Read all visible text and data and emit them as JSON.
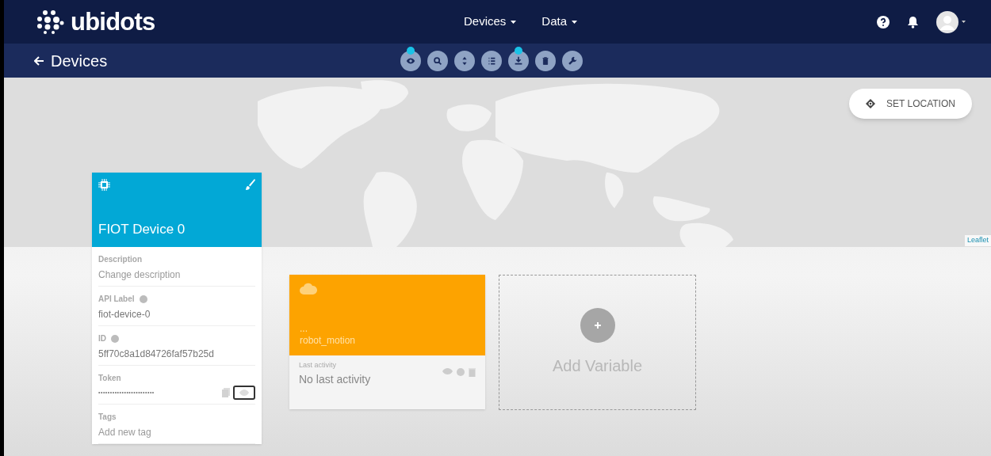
{
  "brand": "ubidots",
  "nav": [
    {
      "label": "Devices"
    },
    {
      "label": "Data"
    }
  ],
  "page_title": "Devices",
  "toolbar": [
    {
      "kind": "eye",
      "badge": true
    },
    {
      "kind": "search",
      "badge": false
    },
    {
      "kind": "sort",
      "badge": false
    },
    {
      "kind": "list",
      "badge": false
    },
    {
      "kind": "download",
      "badge": true
    },
    {
      "kind": "trash",
      "badge": false
    },
    {
      "kind": "wrench",
      "badge": false
    }
  ],
  "set_location": "SET LOCATION",
  "map_attribution": "Leaflet",
  "device": {
    "name": "FIOT Device 0",
    "fields": [
      {
        "label": "Description",
        "info": false,
        "kind": "placeholder",
        "placeholder": "Change description"
      },
      {
        "label": "API Label",
        "info": true,
        "kind": "text",
        "value": "fiot-device-0"
      },
      {
        "label": "ID",
        "info": true,
        "kind": "text",
        "value": "5ff70c8a1d84726faf57b25d"
      },
      {
        "label": "Token",
        "info": false,
        "kind": "secret",
        "value": "••••••••••••••••••••••••"
      },
      {
        "label": "Tags",
        "info": false,
        "kind": "placeholder",
        "placeholder": "Add new tag"
      }
    ]
  },
  "variables": [
    {
      "dots": "...",
      "name": "robot_motion",
      "activity_label": "Last activity",
      "activity": "No last activity"
    }
  ],
  "add_variable": "Add Variable"
}
